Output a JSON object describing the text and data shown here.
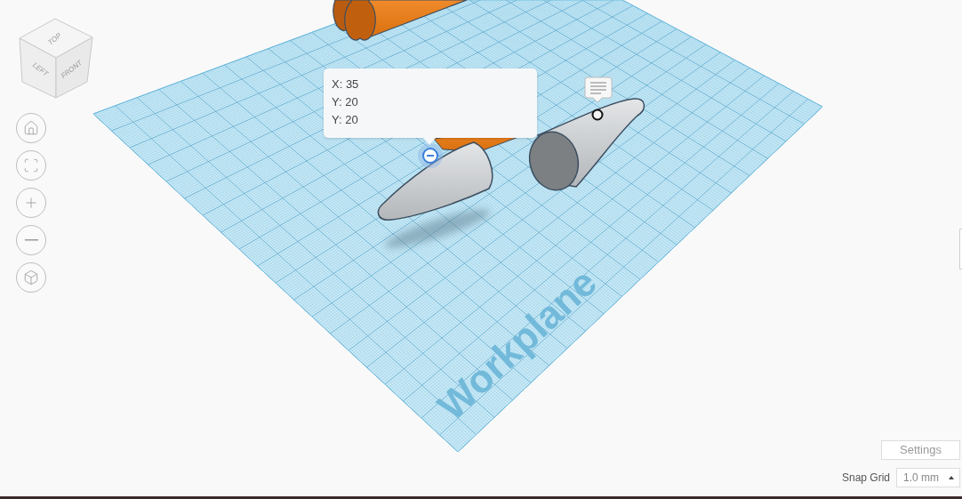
{
  "view_cube": {
    "faces": [
      {
        "kind": "top",
        "label": "TOP"
      },
      {
        "kind": "left",
        "label": "LEFT"
      },
      {
        "kind": "front",
        "label": "FRONT"
      }
    ]
  },
  "workplane": {
    "label": "Workplane"
  },
  "tooltip": {
    "lines": [
      "X: 35",
      "Y: 20",
      "Y: 20"
    ]
  },
  "settings_button": {
    "label": "Settings"
  },
  "snap_grid": {
    "label": "Snap Grid",
    "value": "1.0 mm"
  }
}
